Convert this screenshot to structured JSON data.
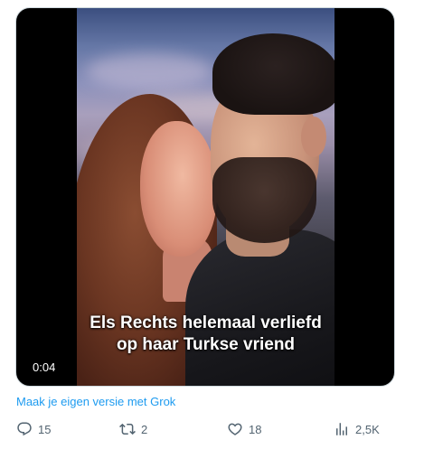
{
  "media": {
    "subtitle_line1": "Els Rechts helemaal verliefd",
    "subtitle_line2": "op haar Turkse vriend",
    "timestamp": "0:04"
  },
  "grok_link": "Maak je eigen versie met Grok",
  "actions": {
    "replies": "15",
    "reposts": "2",
    "likes": "18",
    "views": "2,5K"
  },
  "icons": {
    "reply": "reply-icon",
    "repost": "repost-icon",
    "like": "heart-icon",
    "views": "analytics-icon"
  },
  "colors": {
    "link": "#1d9bf0",
    "muted": "#536471"
  }
}
